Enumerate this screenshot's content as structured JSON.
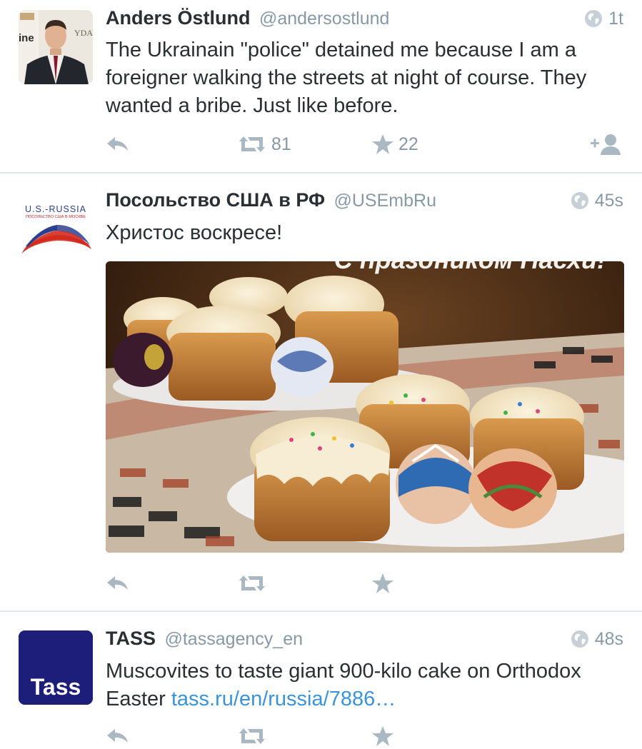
{
  "tweets": [
    {
      "name": "Anders Östlund",
      "handle": "@andersostlund",
      "time": "1t",
      "text": "The Ukrainain \"police\" detained me because I am a foreigner walking the streets at night of course. They wanted a bribe. Just like before.",
      "retweets": "81",
      "favorites": "22",
      "avatar_logo_text": "ine",
      "avatar_sign_text": "YDAY"
    },
    {
      "name": "Посольство США в РФ",
      "handle": "@USEmbRu",
      "time": "45s",
      "text": "Христос воскресе!",
      "avatar_line1": "U.S.-RUSSIA",
      "avatar_line2": "ПОСОЛЬСТВО США В МОСКВЕ",
      "media_caption": "С праздником Пасхи!"
    },
    {
      "name": "TASS",
      "handle": "@tassagency_en",
      "time": "48s",
      "text": "Muscovites to taste giant 900-kilo cake on Orthodox Easter ",
      "link": "tass.ru/en/russia/7886…",
      "avatar_text": "Tass"
    }
  ],
  "colors": {
    "icon_gray": "#aab8c2",
    "meta_gray": "#8899a6",
    "link_blue": "#3b94d9",
    "divider": "#e1e8ed",
    "tass_blue": "#1d1e7a"
  },
  "icons": [
    "reply-icon",
    "retweet-icon",
    "favorite-icon",
    "follow-icon",
    "globe-icon"
  ]
}
